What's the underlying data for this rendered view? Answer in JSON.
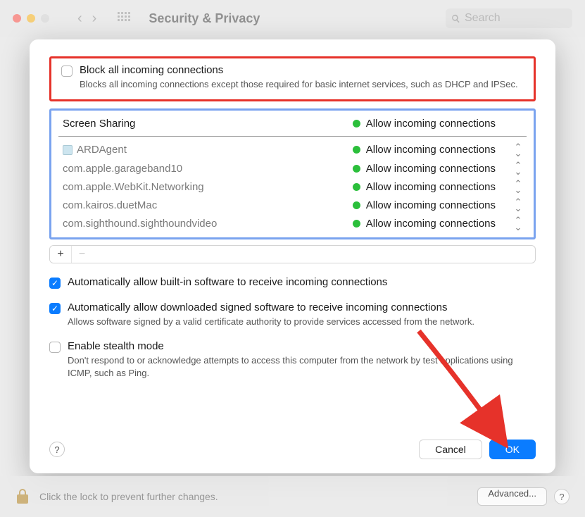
{
  "toolbar": {
    "title": "Security & Privacy",
    "search_placeholder": "Search"
  },
  "block_all": {
    "label": "Block all incoming connections",
    "desc": "Blocks all incoming connections except those required for basic internet services, such as DHCP and IPSec.",
    "checked": false
  },
  "screen_sharing": {
    "label": "Screen Sharing",
    "status": "Allow incoming connections"
  },
  "apps": [
    {
      "name": "ARDAgent",
      "status": "Allow incoming connections",
      "icon": true
    },
    {
      "name": "com.apple.garageband10",
      "status": "Allow incoming connections",
      "icon": false
    },
    {
      "name": "com.apple.WebKit.Networking",
      "status": "Allow incoming connections",
      "icon": false
    },
    {
      "name": "com.kairos.duetMac",
      "status": "Allow incoming connections",
      "icon": false
    },
    {
      "name": "com.sighthound.sighthoundvideo",
      "status": "Allow incoming connections",
      "icon": false
    }
  ],
  "auto_builtin": {
    "label": "Automatically allow built-in software to receive incoming connections",
    "checked": true
  },
  "auto_signed": {
    "label": "Automatically allow downloaded signed software to receive incoming connections",
    "desc": "Allows software signed by a valid certificate authority to provide services accessed from the network.",
    "checked": true
  },
  "stealth": {
    "label": "Enable stealth mode",
    "desc": "Don't respond to or acknowledge attempts to access this computer from the network by test applications using ICMP, such as Ping.",
    "checked": false
  },
  "buttons": {
    "cancel": "Cancel",
    "ok": "OK",
    "help": "?",
    "add": "+",
    "remove": "−"
  },
  "bottom": {
    "lock_text": "Click the lock to prevent further changes.",
    "advanced": "Advanced...",
    "help": "?"
  }
}
